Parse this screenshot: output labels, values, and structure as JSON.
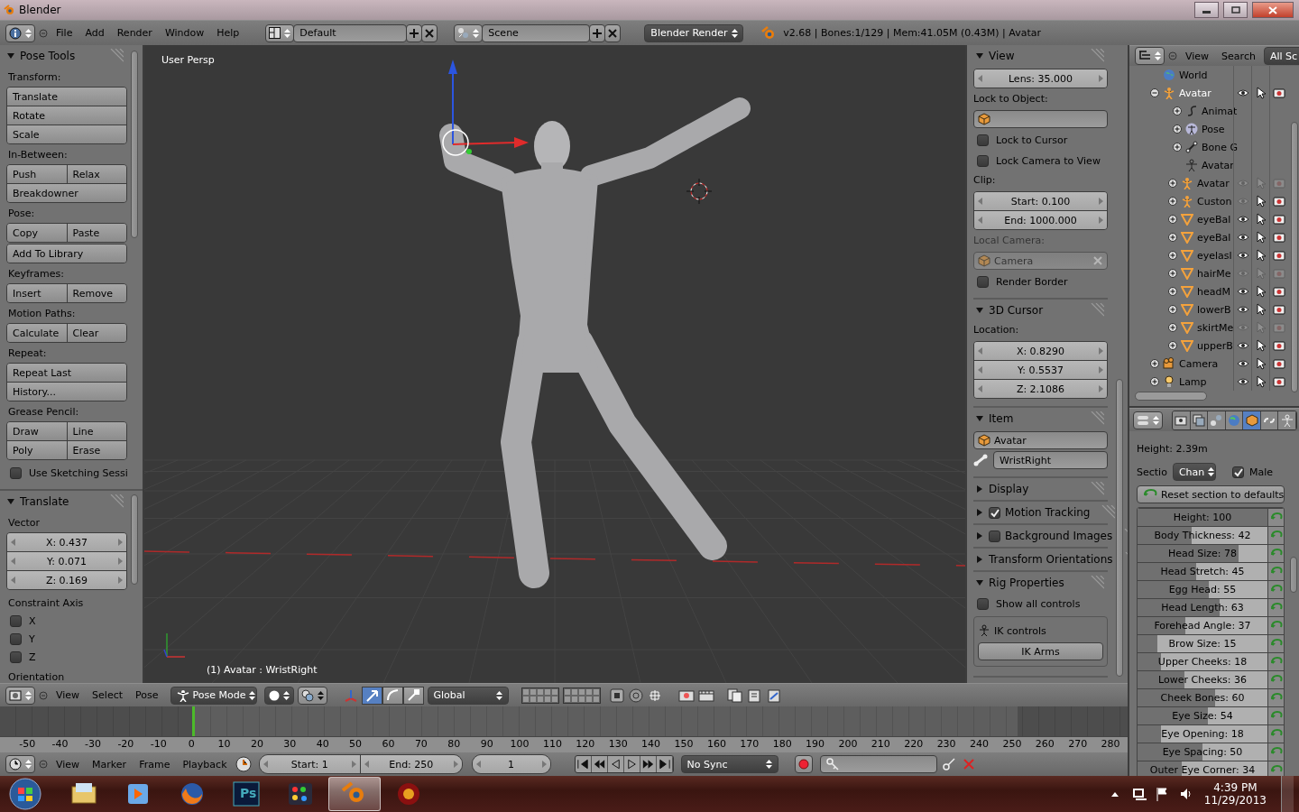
{
  "window": {
    "title": "Blender"
  },
  "info_header": {
    "menus": [
      "File",
      "Add",
      "Render",
      "Window",
      "Help"
    ],
    "screen_layout": "Default",
    "scene": "Scene",
    "render_engine": "Blender Render",
    "stats": "v2.68 | Bones:1/129 | Mem:41.05M (0.43M) | Avatar"
  },
  "tool_shelf": {
    "title": "Pose Tools",
    "expanded": true,
    "groups": [
      {
        "label": "Transform:",
        "blocks": [
          [
            [
              "Translate"
            ],
            [
              "Rotate"
            ],
            [
              "Scale"
            ]
          ]
        ]
      },
      {
        "label": "In-Between:",
        "blocks": [
          [
            [
              "Push",
              "Relax"
            ],
            [
              "Breakdowner"
            ]
          ]
        ]
      },
      {
        "label": "Pose:",
        "blocks": [
          [
            [
              "Copy",
              "Paste"
            ]
          ],
          [
            [
              "Add To Library"
            ]
          ]
        ]
      },
      {
        "label": "Keyframes:",
        "blocks": [
          [
            [
              "Insert",
              "Remove"
            ]
          ]
        ]
      },
      {
        "label": "Motion Paths:",
        "blocks": [
          [
            [
              "Calculate",
              "Clear"
            ]
          ]
        ]
      },
      {
        "label": "Repeat:",
        "blocks": [
          [
            [
              "Repeat Last"
            ],
            [
              "History..."
            ]
          ]
        ]
      },
      {
        "label": "Grease Pencil:",
        "blocks": [
          [
            [
              "Draw",
              "Line"
            ],
            [
              "Poly",
              "Erase"
            ]
          ]
        ]
      }
    ],
    "sketching": {
      "label": "Use Sketching Sessi",
      "checked": false
    }
  },
  "operator_panel": {
    "title": "Translate",
    "expanded": true,
    "vector_label": "Vector",
    "vector": [
      "X: 0.437",
      "Y: 0.071",
      "Z: 0.169"
    ],
    "constraint_label": "Constraint Axis",
    "axes": [
      {
        "label": "X",
        "checked": false
      },
      {
        "label": "Y",
        "checked": false
      },
      {
        "label": "Z",
        "checked": false
      }
    ],
    "orientation_label": "Orientation"
  },
  "viewport": {
    "view_name": "User Persp",
    "object_info": "(1) Avatar : WristRight"
  },
  "view_header": {
    "menus": [
      "View",
      "Select",
      "Pose"
    ],
    "mode": "Pose Mode",
    "manipulators": [
      {
        "kind": "translate",
        "selected": true
      },
      {
        "kind": "rotate",
        "selected": false
      },
      {
        "kind": "scale",
        "selected": false
      }
    ],
    "orientation": "Global"
  },
  "properties_region": {
    "sections": [
      {
        "title": "View",
        "expanded": true,
        "items": [
          {
            "kind": "number",
            "text": "Lens: 35.000"
          },
          {
            "kind": "label",
            "text": "Lock to Object:"
          },
          {
            "kind": "object"
          },
          {
            "kind": "checkbox",
            "text": "Lock to Cursor",
            "checked": false
          },
          {
            "kind": "checkbox",
            "text": "Lock Camera to View",
            "checked": false
          },
          {
            "kind": "label",
            "text": "Clip:"
          },
          {
            "kind": "number",
            "text": "Start: 0.100"
          },
          {
            "kind": "number",
            "text": "End: 1000.000"
          },
          {
            "kind": "label",
            "text": "Local Camera:",
            "disabled": true
          },
          {
            "kind": "object",
            "text": "Camera",
            "disabled": true
          },
          {
            "kind": "checkbox",
            "text": "Render Border",
            "checked": false
          }
        ]
      },
      {
        "title": "3D Cursor",
        "expanded": true,
        "items": [
          {
            "kind": "label",
            "text": "Location:"
          },
          {
            "kind": "number",
            "text": "X: 0.8290"
          },
          {
            "kind": "number",
            "text": "Y: 0.5537"
          },
          {
            "kind": "number",
            "text": "Z: 2.1086"
          }
        ]
      },
      {
        "title": "Item",
        "expanded": true,
        "items": [
          {
            "kind": "object",
            "text": "Avatar"
          },
          {
            "kind": "bone",
            "text": "WristRight"
          }
        ]
      },
      {
        "title": "Display",
        "expanded": false
      },
      {
        "title": "Motion Tracking",
        "expanded": false,
        "checked": true
      },
      {
        "title": "Background Images",
        "expanded": false,
        "checked": false
      },
      {
        "title": "Transform Orientations",
        "expanded": false
      },
      {
        "title": "Rig Properties",
        "expanded": true,
        "items": [
          {
            "kind": "checkbox",
            "text": "Show all controls",
            "checked": false
          },
          {
            "kind": "box_label",
            "text": "IK controls"
          },
          {
            "kind": "toggle",
            "text": "IK Arms"
          }
        ]
      }
    ]
  },
  "outliner": {
    "menus": [
      "View",
      "Search"
    ],
    "filter": "All Sc",
    "tree": [
      {
        "name": "World",
        "kind": "world"
      },
      {
        "name": "Avatar",
        "kind": "armature",
        "expanded": true,
        "visible": true,
        "selectable": true,
        "renderable": true,
        "children": [
          {
            "name": "Animat",
            "kind": "action",
            "expanded": false
          },
          {
            "name": "Pose",
            "kind": "pose",
            "expanded": false
          },
          {
            "name": "Bone G",
            "kind": "bone-group",
            "expanded": false
          },
          {
            "name": "Avatar",
            "kind": "armature-data"
          },
          {
            "name": "Avatar",
            "kind": "armature",
            "expanded": false,
            "visible": false,
            "selectable": false,
            "renderable": false
          },
          {
            "name": "Custon",
            "kind": "armature",
            "expanded": false,
            "visible": false,
            "selectable": true,
            "renderable": true
          },
          {
            "name": "eyeBal",
            "kind": "mesh",
            "expanded": false,
            "visible": true,
            "selectable": true,
            "renderable": true
          },
          {
            "name": "eyeBal",
            "kind": "mesh",
            "expanded": false,
            "visible": true,
            "selectable": true,
            "renderable": true
          },
          {
            "name": "eyelasl",
            "kind": "mesh",
            "expanded": false,
            "visible": true,
            "selectable": true,
            "renderable": true
          },
          {
            "name": "hairMe",
            "kind": "mesh",
            "expanded": false,
            "visible": false,
            "selectable": false,
            "renderable": false
          },
          {
            "name": "headM",
            "kind": "mesh",
            "expanded": false,
            "visible": true,
            "selectable": true,
            "renderable": true
          },
          {
            "name": "lowerB",
            "kind": "mesh",
            "expanded": false,
            "visible": true,
            "selectable": true,
            "renderable": true
          },
          {
            "name": "skirtMe",
            "kind": "mesh",
            "expanded": false,
            "visible": false,
            "selectable": false,
            "renderable": false
          },
          {
            "name": "upperB",
            "kind": "mesh",
            "expanded": false,
            "visible": true,
            "selectable": true,
            "renderable": true
          }
        ]
      },
      {
        "name": "Camera",
        "kind": "camera",
        "expanded": false,
        "visible": true,
        "selectable": true,
        "renderable": true
      },
      {
        "name": "Lamp",
        "kind": "lamp",
        "expanded": false,
        "visible": true,
        "selectable": true,
        "renderable": true
      }
    ]
  },
  "properties": {
    "tabs": [
      {
        "kind": "render",
        "selected": false
      },
      {
        "kind": "render-layers",
        "selected": false
      },
      {
        "kind": "scene",
        "selected": false
      },
      {
        "kind": "world",
        "selected": false
      },
      {
        "kind": "object",
        "selected": true
      },
      {
        "kind": "constraints",
        "selected": false
      },
      {
        "kind": "data",
        "selected": false
      }
    ],
    "height": "Height: 2.39m",
    "section_label": "Sectio",
    "section": "Chan",
    "male": {
      "label": "Male",
      "checked": true
    },
    "reset_button": "Reset section to defaults",
    "sliders": [
      {
        "label": "Height: 100",
        "level": 1.0
      },
      {
        "label": "Body Thickness: 42",
        "level": 0.42
      },
      {
        "label": "Head Size: 78",
        "level": 0.78
      },
      {
        "label": "Head Stretch: 45",
        "level": 0.45
      },
      {
        "label": "Egg Head: 55",
        "level": 0.55
      },
      {
        "label": "Head Length: 63",
        "level": 0.63
      },
      {
        "label": "Forehead Angle: 37",
        "level": 0.37
      },
      {
        "label": "Brow Size: 15",
        "level": 0.15
      },
      {
        "label": "Upper Cheeks: 18",
        "level": 0.18
      },
      {
        "label": "Lower Cheeks: 36",
        "level": 0.36
      },
      {
        "label": "Cheek Bones: 60",
        "level": 0.6
      },
      {
        "label": "Eye Size: 54",
        "level": 0.54
      },
      {
        "label": "Eye Opening: 18",
        "level": 0.18
      },
      {
        "label": "Eye Spacing: 50",
        "level": 0.5
      },
      {
        "label": "Outer Eye Corner: 34",
        "level": 0.34
      }
    ]
  },
  "timeline": {
    "ruler": [
      "-50",
      "-40",
      "-30",
      "-20",
      "-10",
      "0",
      "10",
      "20",
      "30",
      "40",
      "50",
      "60",
      "70",
      "80",
      "90",
      "100",
      "110",
      "120",
      "130",
      "140",
      "150",
      "160",
      "170",
      "180",
      "190",
      "200",
      "210",
      "220",
      "230",
      "240",
      "250",
      "260",
      "270",
      "280"
    ]
  },
  "timeline_header": {
    "menus": [
      "View",
      "Marker",
      "Frame",
      "Playback"
    ],
    "start": "Start: 1",
    "end": "End: 250",
    "current_frame": "1",
    "sync": "No Sync"
  },
  "taskbar": {
    "apps": [
      {
        "kind": "explorer",
        "selected": false
      },
      {
        "kind": "media-player",
        "selected": false
      },
      {
        "kind": "firefox",
        "selected": false
      },
      {
        "kind": "photoshop",
        "label": "Ps",
        "selected": false
      },
      {
        "kind": "paint",
        "selected": false
      },
      {
        "kind": "blender",
        "selected": true
      },
      {
        "kind": "game",
        "selected": false
      }
    ],
    "time": "4:39 PM",
    "date": "11/29/2013"
  }
}
